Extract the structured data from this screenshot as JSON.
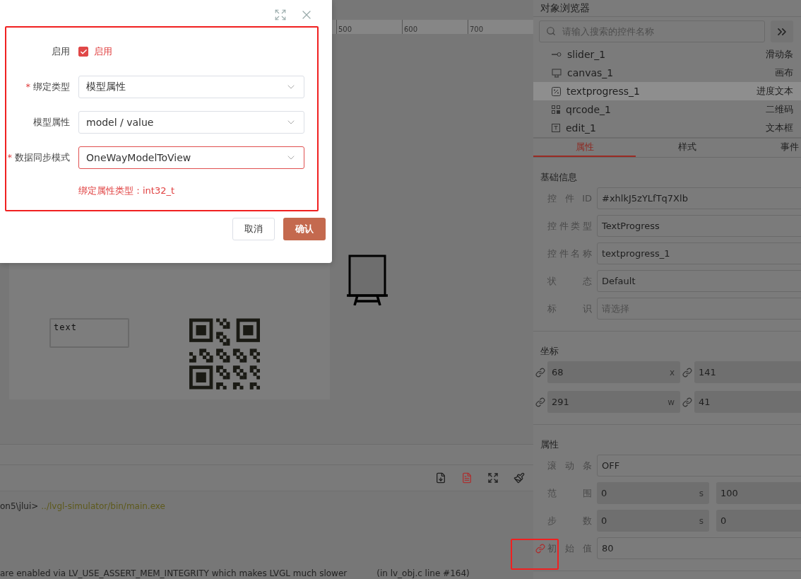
{
  "ruler": {
    "ticks": [
      "500",
      "600",
      "700"
    ]
  },
  "canvas": {
    "widgets": [
      {
        "kind": "textbox",
        "text": "text"
      },
      {
        "kind": "qrcode"
      },
      {
        "kind": "easel"
      }
    ]
  },
  "toolbar": {
    "tools": [
      {
        "kind": "file",
        "active": false
      },
      {
        "kind": "document",
        "active": true
      },
      {
        "kind": "expand",
        "active": false
      },
      {
        "kind": "brush",
        "active": false
      }
    ]
  },
  "console": {
    "lines": [
      {
        "prompt": "on5\\jlui>",
        "command": "../lvgl-simulator/bin/main.exe"
      },
      {
        "message": "are enabled via LV_USE_ASSERT_MEM_INTEGRITY which makes LVGL much slower",
        "source": "(in lv_obj.c line #164)"
      }
    ]
  },
  "object_browser": {
    "title": "对象浏览器",
    "search": {
      "placeholder": "请输入搜索的控件名称"
    },
    "items": [
      {
        "kind": "slider",
        "name": "slider_1",
        "type": "滑动条",
        "selected": false
      },
      {
        "kind": "canvas",
        "name": "canvas_1",
        "type": "画布",
        "selected": false
      },
      {
        "kind": "textprogress",
        "name": "textprogress_1",
        "type": "进度文本",
        "selected": true
      },
      {
        "kind": "qrcode",
        "name": "qrcode_1",
        "type": "二维码",
        "selected": false
      },
      {
        "kind": "edit",
        "name": "edit_1",
        "type": "文本框",
        "selected": false
      }
    ]
  },
  "tabs": [
    {
      "label": "属性",
      "selected": true
    },
    {
      "label": "样式",
      "selected": false
    },
    {
      "label": "事件",
      "selected": false
    }
  ],
  "basic_info": {
    "title": "基础信息",
    "fields": [
      {
        "label": "控件ID",
        "value": "#xhlkJ5zYLfTq7Xlb"
      },
      {
        "label": "控件类型",
        "value": "TextProgress"
      },
      {
        "label": "控件名称",
        "value": "textprogress_1"
      },
      {
        "label": "状态",
        "value": "Default"
      },
      {
        "label": "标识",
        "placeholder": "请选择"
      }
    ]
  },
  "coordinates": {
    "title": "坐标",
    "rows": [
      {
        "inputs": [
          {
            "value": "68",
            "suffix": "x",
            "bound": false
          },
          {
            "value": "141",
            "bound": false
          }
        ]
      },
      {
        "inputs": [
          {
            "value": "291",
            "suffix": "w",
            "bound": false
          },
          {
            "value": "41",
            "bound": false
          }
        ]
      }
    ]
  },
  "properties": {
    "title": "属性",
    "rows": [
      {
        "kind": "single",
        "label": "滚动条",
        "inputs": [
          {
            "value": "OFF"
          }
        ]
      },
      {
        "kind": "pair",
        "label": "范围",
        "inputs": [
          {
            "value": "0",
            "suffix": "s"
          },
          {
            "value": "100"
          }
        ]
      },
      {
        "kind": "pair",
        "label": "步数",
        "inputs": [
          {
            "value": "0",
            "suffix": "s"
          },
          {
            "value": "0"
          }
        ]
      },
      {
        "kind": "single",
        "label": "初始值",
        "bound": true,
        "inputs": [
          {
            "value": "80"
          }
        ]
      }
    ]
  },
  "dialog": {
    "required_mark": "*",
    "enable": {
      "label": "启用",
      "checked": true,
      "text": "启用"
    },
    "fields": [
      {
        "label": "绑定类型",
        "required": true,
        "value": "模型属性",
        "focused": false
      },
      {
        "label": "模型属性",
        "required": false,
        "value": "model / value",
        "focused": false
      },
      {
        "label": "数据同步模式",
        "required": true,
        "value": "OneWayModelToView",
        "focused": true
      }
    ],
    "hint": "绑定属性类型：int32_t",
    "buttons": [
      {
        "label": "取消",
        "kind": "default"
      },
      {
        "label": "确认",
        "kind": "primary"
      }
    ]
  }
}
